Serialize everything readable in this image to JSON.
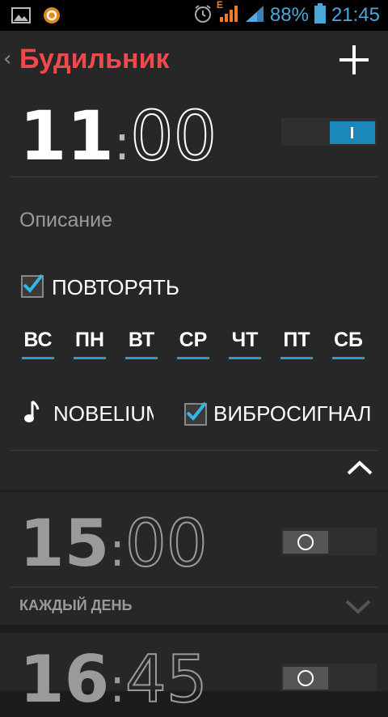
{
  "status_bar": {
    "battery_percent": "88%",
    "clock": "21:45",
    "network_type": "E",
    "icons": [
      "gallery-icon",
      "app-notification-icon",
      "alarm-icon",
      "signal-icon",
      "signal-icon",
      "battery-icon"
    ]
  },
  "action_bar": {
    "title": "Будильник",
    "add_icon": "plus-icon"
  },
  "alarms": [
    {
      "hours": "11",
      "colon": ":",
      "minutes": "00",
      "enabled": true,
      "description_label": "Описание",
      "repeat_label": "ПОВТОРЯТЬ",
      "repeat_checked": true,
      "days": [
        "ВС",
        "ПН",
        "ВТ",
        "СР",
        "ЧТ",
        "ПТ",
        "СБ"
      ],
      "ringtone": "NOBELIUM",
      "vibrate_label": "ВИБРОСИГНАЛ",
      "vibrate_checked": true
    },
    {
      "hours": "15",
      "colon": ":",
      "minutes": "00",
      "enabled": false,
      "repeat_summary": "КАЖДЫЙ ДЕНЬ"
    },
    {
      "hours": "16",
      "colon": ":",
      "minutes": "45",
      "enabled": false
    }
  ],
  "colors": {
    "accent_title": "#f0494d",
    "accent_blue": "#2d9ad0",
    "background": "#1c1c1c",
    "card": "#272727"
  }
}
